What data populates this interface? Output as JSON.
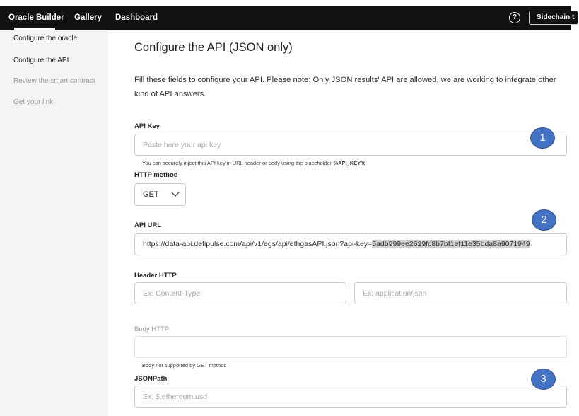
{
  "nav": {
    "brand": "Oracle Builder",
    "gallery": "Gallery",
    "dashboard": "Dashboard",
    "help_icon": "question-circle-icon",
    "sidechain_button": "Sidechain t"
  },
  "sidebar": {
    "items": [
      {
        "label": "Configure the oracle",
        "state": "done"
      },
      {
        "label": "Configure the API",
        "state": "current"
      },
      {
        "label": "Review the smart contract",
        "state": "pending"
      },
      {
        "label": "Get your link",
        "state": "pending"
      }
    ]
  },
  "main": {
    "title": "Configure the API (JSON only)",
    "description": "Fill these fields to configure your API. Please note: Only JSON results' API are allowed, we are working to integrate other kind of API answers.",
    "api_key": {
      "label": "API Key",
      "placeholder": "Paste here your api key",
      "hint_prefix": "You can securely inject this API key in URL header or body using the placeholder",
      "hint_token": "%API_KEY%"
    },
    "http_method": {
      "label": "HTTP method",
      "value": "GET"
    },
    "api_url": {
      "label": "API URL",
      "value_plain": "https://data-api.defipulse.com/api/v1/egs/api/ethgasAPI.json?api-key=",
      "value_selected": "5adb999ee2629fc8b7bf1ef11e35bda8a9071949"
    },
    "header_http": {
      "label": "Header HTTP",
      "key_placeholder": "Ex: Content-Type",
      "value_placeholder": "Ex: application/json"
    },
    "body_http": {
      "label": "Body HTTP",
      "hint": "Body not supported by GET method"
    },
    "json_path": {
      "label": "JSONPath",
      "placeholder": "Ex: $.ethereum.usd"
    }
  },
  "annotations": {
    "badge_1": "1",
    "badge_2": "2",
    "badge_3": "3",
    "badge_color": "#4472c4"
  }
}
